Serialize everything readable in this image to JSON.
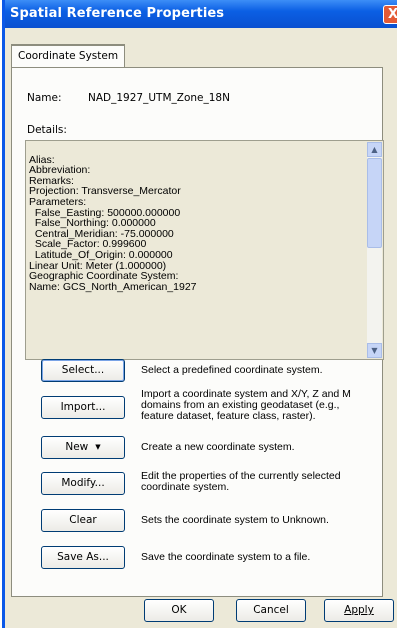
{
  "window": {
    "title": "Spatial Reference Properties",
    "close_glyph": "X"
  },
  "tabs": [
    "Coordinate System"
  ],
  "name": {
    "label": "Name:",
    "value": "NAD_1927_UTM_Zone_18N"
  },
  "details": {
    "label": "Details:",
    "lines": [
      "Alias:",
      "Abbreviation:",
      "Remarks:",
      "Projection: Transverse_Mercator",
      "Parameters:",
      "  False_Easting: 500000.000000",
      "  False_Northing: 0.000000",
      "  Central_Meridian: -75.000000",
      "  Scale_Factor: 0.999600",
      "  Latitude_Of_Origin: 0.000000",
      "Linear Unit: Meter (1.000000)",
      "Geographic Coordinate System:",
      "Name: GCS_North_American_1927"
    ]
  },
  "actions": [
    {
      "label": "Select...",
      "description": "Select a predefined coordinate system."
    },
    {
      "label": "Import...",
      "description": "Import a coordinate system and X/Y, Z and M domains from an existing geodataset (e.g., feature dataset, feature class, raster)."
    },
    {
      "label": "New",
      "description": "Create a new coordinate system."
    },
    {
      "label": "Modify...",
      "description": "Edit the properties of the currently selected coordinate system."
    },
    {
      "label": "Clear",
      "description": "Sets the coordinate system to Unknown."
    },
    {
      "label": "Save As...",
      "description": "Save the coordinate system to a file."
    }
  ],
  "footer": {
    "ok": "OK",
    "cancel": "Cancel",
    "apply": "Apply"
  },
  "icons": {
    "scroll_up": "scroll-up-arrow-icon",
    "scroll_down": "scroll-down-arrow-icon",
    "new_dropdown": "dropdown-arrow-icon"
  },
  "colors": {
    "title_bar": "#0a5fe4",
    "dialog_face": "#ece9d8",
    "close_button": "#e45a35"
  }
}
